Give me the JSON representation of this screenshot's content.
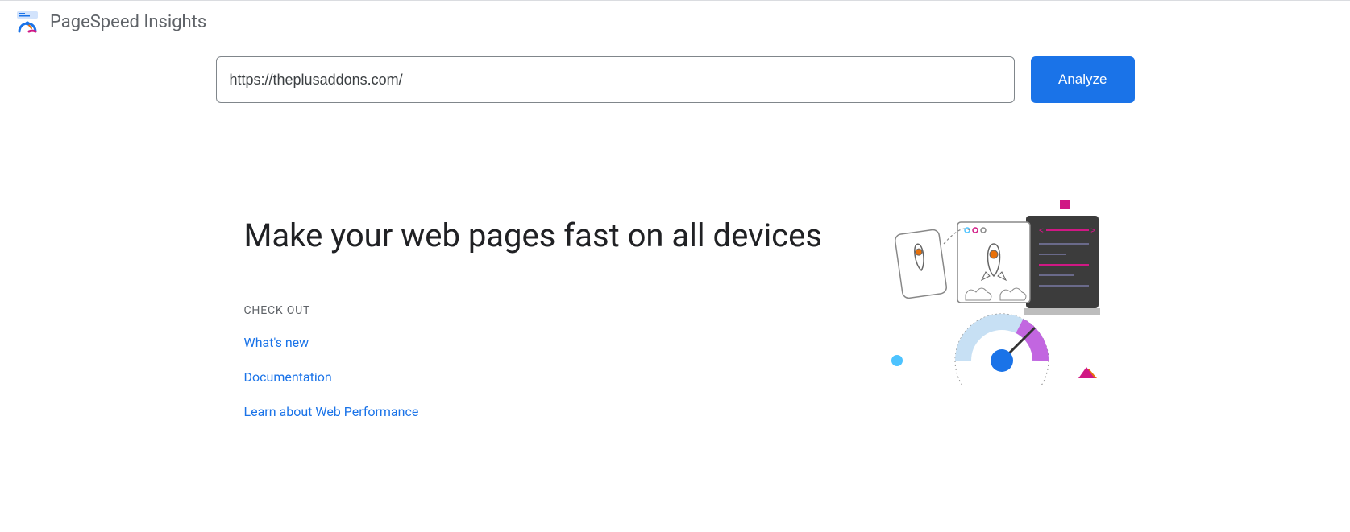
{
  "header": {
    "product_title": "PageSpeed Insights"
  },
  "search": {
    "url_value": "https://theplusaddons.com/",
    "analyze_label": "Analyze"
  },
  "main": {
    "hero": "Make your web pages fast on all devices",
    "checkout_label": "CHECK OUT",
    "links": [
      {
        "label": "What's new"
      },
      {
        "label": "Documentation"
      },
      {
        "label": "Learn about Web Performance"
      }
    ]
  }
}
